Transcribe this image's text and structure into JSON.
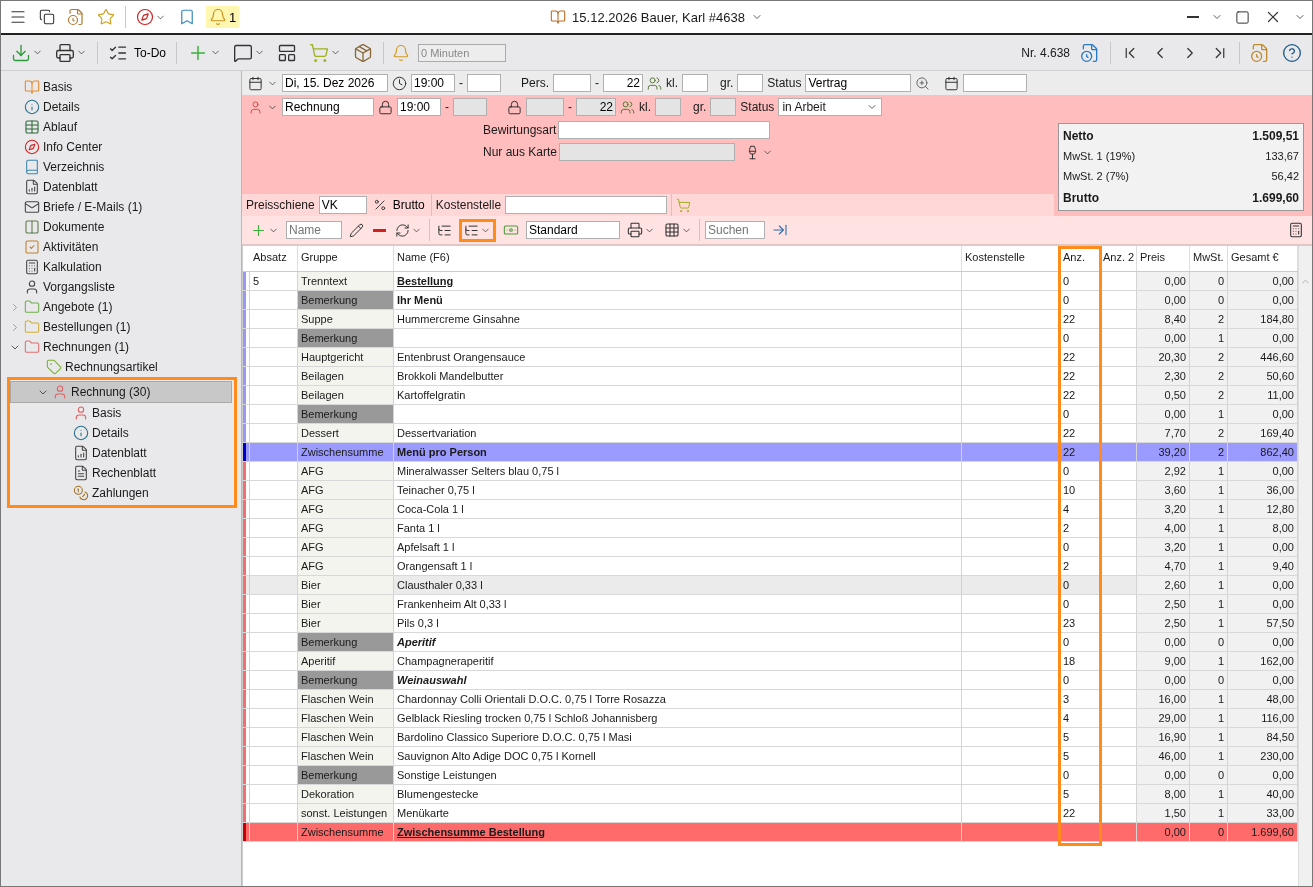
{
  "window": {
    "title": "15.12.2026 Bauer, Karl #4638",
    "notification_count": "1"
  },
  "toolbar": {
    "todo": "To-Do",
    "timer": "0 Minuten",
    "number": "Nr. 4.638"
  },
  "sidebar": {
    "items": [
      {
        "label": "Basis",
        "selected": false
      },
      {
        "label": "Details",
        "selected": false
      },
      {
        "label": "Ablauf",
        "selected": false
      },
      {
        "label": "Info Center",
        "selected": false
      },
      {
        "label": "Verzeichnis",
        "selected": false
      },
      {
        "label": "Datenblatt",
        "selected": false
      },
      {
        "label": "Briefe / E-Mails (1)",
        "selected": false
      },
      {
        "label": "Dokumente",
        "selected": false
      },
      {
        "label": "Aktivitäten",
        "selected": false
      },
      {
        "label": "Kalkulation",
        "selected": false
      },
      {
        "label": "Vorgangsliste",
        "selected": false
      },
      {
        "label": "Angebote (1)",
        "selected": false,
        "expanded": false
      },
      {
        "label": "Bestellungen (1)",
        "selected": false,
        "expanded": false
      },
      {
        "label": "Rechnungen (1)",
        "selected": false,
        "expanded": true,
        "children": [
          {
            "label": "Rechnungsartikel",
            "selected": false
          },
          {
            "label": "Rechnung (30)",
            "selected": true,
            "expanded": true,
            "highlighted": true,
            "children": [
              {
                "label": "Basis",
                "selected": false
              },
              {
                "label": "Details",
                "selected": false
              },
              {
                "label": "Datenblatt",
                "selected": false
              },
              {
                "label": "Rechenblatt",
                "selected": false
              },
              {
                "label": "Zahlungen",
                "selected": false
              }
            ]
          }
        ]
      }
    ]
  },
  "booking": {
    "date": "Di, 15. Dez 2026",
    "time_from": {
      "value": "19:00",
      "disabled": false
    },
    "time_to": {
      "disabled": false
    },
    "time_sep": "-",
    "pers_label": "Pers.",
    "pers_from": {
      "disabled": false
    },
    "pers_sep": "-",
    "pers_to": {
      "value": "22",
      "disabled": false
    },
    "kl_label": "kl.",
    "kl": {
      "disabled": false
    },
    "gr_label": "gr.",
    "gr": {
      "disabled": false
    },
    "status_label": "Status",
    "status": "Vertrag"
  },
  "invoice": {
    "type": "Rechnung",
    "time_from": {
      "value": "19:00",
      "disabled": false
    },
    "time_to": {
      "disabled": true
    },
    "time_sep": "-",
    "pers_from": {
      "disabled": true
    },
    "pers_sep": "-",
    "pers_to": {
      "value": "22",
      "disabled": true
    },
    "kl_label": "kl.",
    "kl": {
      "disabled": true
    },
    "gr_label": "gr.",
    "gr": {
      "disabled": true
    },
    "status_label": "Status",
    "status": "in Arbeit"
  },
  "hospitality": {
    "label": "Bewirtungsart"
  },
  "menu_only": {
    "label": "Nur aus Karte",
    "disabled": true
  },
  "pricing": {
    "price_label": "Preisschiene",
    "price_value": "VK",
    "gross_label": "Brutto",
    "cost_label": "Kostenstelle"
  },
  "totals": [
    {
      "kind": "net",
      "label": "Netto",
      "value": "1.509,51"
    },
    {
      "kind": "tax",
      "label": "MwSt. 1 (19%)",
      "value": "133,67"
    },
    {
      "kind": "tax",
      "label": "MwSt. 2 (7%)",
      "value": "56,42"
    },
    {
      "kind": "gross",
      "label": "Brutto",
      "value": "1.699,60"
    }
  ],
  "table_toolbar": {
    "name_placeholder": "Name",
    "layout": "Standard",
    "search_placeholder": "Suchen",
    "expand_button": {
      "highlighted": true
    }
  },
  "table": {
    "columns": [
      {
        "label": "Absatz"
      },
      {
        "label": "Gruppe"
      },
      {
        "label": "Name (F6)"
      },
      {
        "label": "Kostenstelle"
      },
      {
        "label": "Anz.",
        "highlighted": true
      },
      {
        "label": "Anz. 2"
      },
      {
        "label": "Preis"
      },
      {
        "label": "MwSt."
      },
      {
        "label": "Gesamt €"
      }
    ],
    "rows": [
      {
        "kind": "separator",
        "color": "#9999ee",
        "selected": false,
        "absatz": "5",
        "group": "Trenntext",
        "name": "Bestellung",
        "qty": "0",
        "price": "0,00",
        "vat": "0",
        "total": "0,00"
      },
      {
        "kind": "remark_title",
        "color": "#9999ee",
        "selected": false,
        "group": "Bemerkung",
        "name": "Ihr Menü",
        "qty": "0",
        "price": "0,00",
        "vat": "0",
        "total": "0,00"
      },
      {
        "kind": "item",
        "color": "#9999ee",
        "selected": false,
        "group": "Suppe",
        "name": "Hummercreme Ginsahne",
        "qty": "22",
        "price": "8,40",
        "vat": "2",
        "total": "184,80"
      },
      {
        "kind": "remark",
        "color": "#9999ee",
        "selected": false,
        "group": "Bemerkung",
        "qty": "0",
        "price": "0,00",
        "vat": "1",
        "total": "0,00"
      },
      {
        "kind": "item",
        "color": "#9999ee",
        "selected": false,
        "group": "Hauptgericht",
        "name": "Entenbrust Orangensauce",
        "qty": "22",
        "price": "20,30",
        "vat": "2",
        "total": "446,60"
      },
      {
        "kind": "item",
        "color": "#9999ee",
        "selected": false,
        "group": "Beilagen",
        "name": "Brokkoli Mandelbutter",
        "qty": "22",
        "price": "2,30",
        "vat": "2",
        "total": "50,60"
      },
      {
        "kind": "item",
        "color": "#9999ee",
        "selected": false,
        "group": "Beilagen",
        "name": "Kartoffelgratin",
        "qty": "22",
        "price": "0,50",
        "vat": "2",
        "total": "11,00"
      },
      {
        "kind": "remark",
        "color": "#9999ee",
        "selected": false,
        "group": "Bemerkung",
        "qty": "0",
        "price": "0,00",
        "vat": "1",
        "total": "0,00"
      },
      {
        "kind": "item",
        "color": "#9999ee",
        "selected": false,
        "group": "Dessert",
        "name": "Dessertvariation",
        "qty": "22",
        "price": "7,70",
        "vat": "2",
        "total": "169,40"
      },
      {
        "kind": "subtotal",
        "color": "#0000cc",
        "selected": false,
        "group": "Zwischensumme",
        "name": "Menü pro Person",
        "qty": "22",
        "price": "39,20",
        "vat": "2",
        "total": "862,40"
      },
      {
        "kind": "item",
        "color": "#f07070",
        "selected": false,
        "group": "AFG",
        "name": "Mineralwasser Selters blau 0,75 l",
        "qty": "0",
        "price": "2,92",
        "vat": "1",
        "total": "0,00"
      },
      {
        "kind": "item",
        "color": "#f07070",
        "selected": false,
        "group": "AFG",
        "name": "Teinacher 0,75 l",
        "qty": "10",
        "price": "3,60",
        "vat": "1",
        "total": "36,00"
      },
      {
        "kind": "item",
        "color": "#f07070",
        "selected": false,
        "group": "AFG",
        "name": "Coca-Cola 1 l",
        "qty": "4",
        "price": "3,20",
        "vat": "1",
        "total": "12,80"
      },
      {
        "kind": "item",
        "color": "#f07070",
        "selected": false,
        "group": "AFG",
        "name": "Fanta 1 l",
        "qty": "2",
        "price": "4,00",
        "vat": "1",
        "total": "8,00"
      },
      {
        "kind": "item",
        "color": "#f07070",
        "selected": false,
        "group": "AFG",
        "name": "Apfelsaft 1 l",
        "qty": "0",
        "price": "3,20",
        "vat": "1",
        "total": "0,00"
      },
      {
        "kind": "item",
        "color": "#f07070",
        "selected": false,
        "group": "AFG",
        "name": "Orangensaft 1 l",
        "qty": "2",
        "price": "4,70",
        "vat": "1",
        "total": "9,40"
      },
      {
        "kind": "item",
        "color": "#f07070",
        "selected": true,
        "group": "Bier",
        "name": "Clausthaler 0,33 l",
        "qty": "0",
        "price": "2,60",
        "vat": "1",
        "total": "0,00"
      },
      {
        "kind": "item",
        "color": "#f07070",
        "selected": false,
        "group": "Bier",
        "name": "Frankenheim Alt  0,33 l",
        "qty": "0",
        "price": "2,50",
        "vat": "1",
        "total": "0,00"
      },
      {
        "kind": "item",
        "color": "#f07070",
        "selected": false,
        "group": "Bier",
        "name": "Pils 0,3 l",
        "qty": "23",
        "price": "2,50",
        "vat": "1",
        "total": "57,50"
      },
      {
        "kind": "remark_section",
        "color": "#f07070",
        "selected": false,
        "group": "Bemerkung",
        "name": "Aperitif",
        "qty": "0",
        "price": "0,00",
        "vat": "0",
        "total": "0,00"
      },
      {
        "kind": "item",
        "color": "#f07070",
        "selected": false,
        "group": "Aperitif",
        "name": "Champagneraperitif",
        "qty": "18",
        "price": "9,00",
        "vat": "1",
        "total": "162,00"
      },
      {
        "kind": "remark_section",
        "color": "#f07070",
        "selected": false,
        "group": "Bemerkung",
        "name": "Weinauswahl",
        "qty": "0",
        "price": "0,00",
        "vat": "0",
        "total": "0,00"
      },
      {
        "kind": "item",
        "color": "#f07070",
        "selected": false,
        "group": "Flaschen Wein",
        "name": "Chardonnay Colli Orientali D.O.C. 0,75 l Torre Rosazza",
        "qty": "3",
        "price": "16,00",
        "vat": "1",
        "total": "48,00"
      },
      {
        "kind": "item",
        "color": "#f07070",
        "selected": false,
        "group": "Flaschen Wein",
        "name": "Gelblack Riesling trocken 0,75 l Schloß Johannisberg",
        "qty": "4",
        "price": "29,00",
        "vat": "1",
        "total": "116,00"
      },
      {
        "kind": "item",
        "color": "#f07070",
        "selected": false,
        "group": "Flaschen Wein",
        "name": "Bardolino Classico Superiore D.O.C. 0,75 l Masi",
        "qty": "5",
        "price": "16,90",
        "vat": "1",
        "total": "84,50"
      },
      {
        "kind": "item",
        "color": "#f07070",
        "selected": false,
        "group": "Flaschen Wein",
        "name": "Sauvignon Alto Adige DOC 0,75 l Kornell",
        "qty": "5",
        "price": "46,00",
        "vat": "1",
        "total": "230,00"
      },
      {
        "kind": "remark",
        "color": "#f07070",
        "selected": false,
        "group": "Bemerkung",
        "name": "Sonstige Leistungen",
        "qty": "0",
        "price": "0,00",
        "vat": "0",
        "total": "0,00"
      },
      {
        "kind": "item",
        "color": "#f07070",
        "selected": false,
        "group": "Dekoration",
        "name": "Blumengestecke",
        "qty": "5",
        "price": "8,00",
        "vat": "1",
        "total": "40,00"
      },
      {
        "kind": "item",
        "color": "#f07070",
        "selected": false,
        "group": "sonst. Leistungen",
        "name": "Menükarte",
        "qty": "22",
        "price": "1,50",
        "vat": "1",
        "total": "33,00"
      },
      {
        "kind": "total",
        "color": "#cc0000",
        "selected": false,
        "group": "Zwischensumme",
        "name": "Zwischensumme Bestellung",
        "price": "0,00",
        "vat": "0",
        "total": "1.699,60"
      }
    ]
  }
}
